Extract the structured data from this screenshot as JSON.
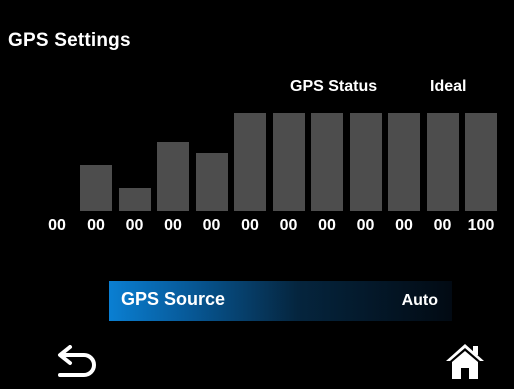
{
  "header": {
    "title": "GPS Settings"
  },
  "status": {
    "label": "GPS Status",
    "value": "Ideal"
  },
  "chart_data": {
    "type": "bar",
    "values": [
      0.4,
      0.2,
      0.6,
      0.5,
      0.85,
      0.85,
      0.85,
      0.85,
      0.85,
      0.85,
      0.85
    ],
    "labels": [
      "00",
      "00",
      "00",
      "00",
      "00",
      "00",
      "00",
      "00",
      "00",
      "00",
      "00",
      "100"
    ]
  },
  "source": {
    "label": "GPS Source",
    "value": "Auto"
  },
  "nav": {
    "back_icon": "back-arrow-icon",
    "home_icon": "home-icon"
  },
  "colors": {
    "background": "#000000",
    "bar": "#4d4d4d",
    "accent": "#0a7fd2",
    "text": "#ffffff"
  }
}
